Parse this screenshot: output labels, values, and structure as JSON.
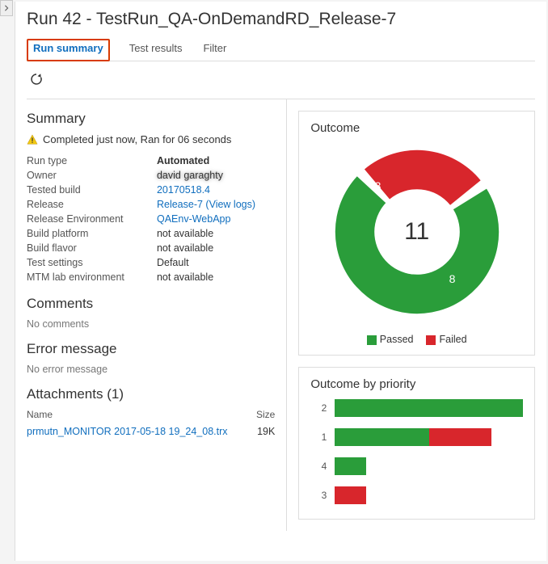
{
  "header": {
    "title": "Run 42 - TestRun_QA-OnDemandRD_Release-7"
  },
  "tabs": [
    {
      "label": "Run summary",
      "active": true
    },
    {
      "label": "Test results",
      "active": false
    },
    {
      "label": "Filter",
      "active": false
    }
  ],
  "summary": {
    "title": "Summary",
    "status_text": "Completed just now, Ran for 06 seconds",
    "fields": {
      "run_type": {
        "label": "Run type",
        "value": "Automated"
      },
      "owner": {
        "label": "Owner",
        "value": "david garaghty"
      },
      "tested_build": {
        "label": "Tested build",
        "value": "20170518.4",
        "link": true
      },
      "release": {
        "label": "Release",
        "value": "Release-7 (View logs)",
        "link": true
      },
      "release_env": {
        "label": "Release Environment",
        "value": "QAEnv-WebApp",
        "link": true
      },
      "build_platform": {
        "label": "Build platform",
        "value": "not available"
      },
      "build_flavor": {
        "label": "Build flavor",
        "value": "not available"
      },
      "test_settings": {
        "label": "Test settings",
        "value": "Default"
      },
      "mtm_lab": {
        "label": "MTM lab environment",
        "value": "not available"
      }
    }
  },
  "comments": {
    "title": "Comments",
    "body": "No comments"
  },
  "error": {
    "title": "Error message",
    "body": "No error message"
  },
  "attachments": {
    "title": "Attachments (1)",
    "columns": {
      "name": "Name",
      "size": "Size"
    },
    "rows": [
      {
        "name": "prmutn_MONITOR 2017-05-18 19_24_08.trx",
        "size": "19K"
      }
    ]
  },
  "outcome": {
    "title": "Outcome",
    "legend": {
      "passed": "Passed",
      "failed": "Failed"
    }
  },
  "outcome_priority": {
    "title": "Outcome by priority"
  },
  "colors": {
    "passed": "#2a9d3a",
    "failed": "#d8262c"
  },
  "chart_data": [
    {
      "type": "pie",
      "title": "Outcome",
      "series": [
        {
          "name": "Passed",
          "value": 8,
          "color": "#2a9d3a"
        },
        {
          "name": "Failed",
          "value": 3,
          "color": "#d8262c"
        }
      ],
      "total": 11
    },
    {
      "type": "bar",
      "title": "Outcome by priority",
      "categories": [
        "2",
        "1",
        "4",
        "3"
      ],
      "series": [
        {
          "name": "Passed",
          "values": [
            6,
            3,
            1,
            0
          ],
          "color": "#2a9d3a"
        },
        {
          "name": "Failed",
          "values": [
            0,
            2,
            0,
            1
          ],
          "color": "#d8262c"
        }
      ],
      "xlim": [
        0,
        6
      ]
    }
  ]
}
